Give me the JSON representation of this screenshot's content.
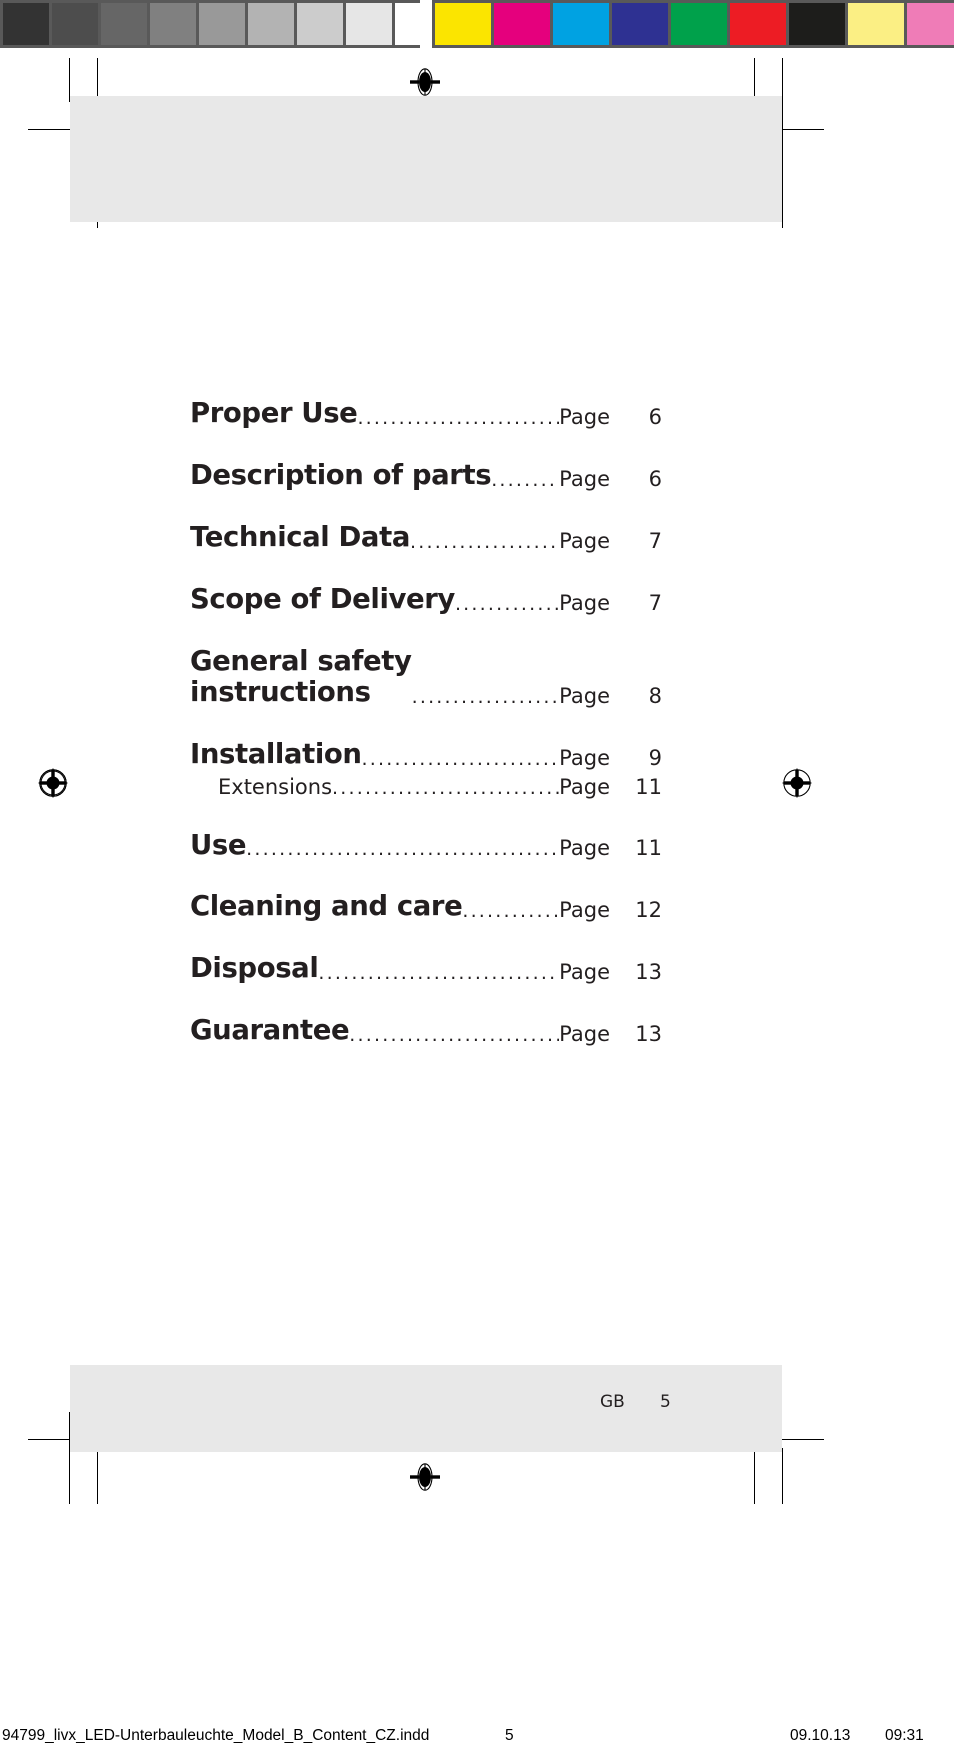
{
  "document": {
    "language_code": "GB",
    "page_number": "5",
    "band_color": "#e8e8e8",
    "text_color": "#231f20"
  },
  "prepress": {
    "gray_bar": {
      "name": "grayscale-control-bar",
      "border_color": "#595959",
      "swatches": [
        "#333333",
        "#4d4d4d",
        "#666666",
        "#808080",
        "#999999",
        "#b3b3b3",
        "#cccccc",
        "#e6e6e6",
        "#ffffff"
      ]
    },
    "color_bar": {
      "name": "process-color-control-bar",
      "border_color": "#595959",
      "swatches": [
        "#fbe500",
        "#e5007d",
        "#00a2e2",
        "#2e3192",
        "#00a14b",
        "#ed1c24",
        "#1d1d1b",
        "#fbef84",
        "#ef7cb7"
      ]
    },
    "registration_marks": 4,
    "crop_marks": true
  },
  "toc": {
    "entries": [
      {
        "title": "Proper Use",
        "page_label": "Page",
        "page": "6",
        "level": 1
      },
      {
        "title": "Description of parts",
        "page_label": "Page",
        "page": "6",
        "level": 1
      },
      {
        "title": "Technical Data",
        "page_label": "Page",
        "page": "7",
        "level": 1
      },
      {
        "title": "Scope of Delivery",
        "page_label": "Page",
        "page": "7",
        "level": 1
      },
      {
        "title": "General safety\ninstructions",
        "page_label": "Page",
        "page": "8",
        "level": 1
      },
      {
        "title": "Installation",
        "page_label": "Page",
        "page": "9",
        "level": 1
      },
      {
        "title": "Extensions",
        "page_label": "Page",
        "page": "11",
        "level": 2
      },
      {
        "title": "Use",
        "page_label": "Page",
        "page": "11",
        "level": 1
      },
      {
        "title": "Cleaning and care",
        "page_label": "Page",
        "page": "12",
        "level": 1
      },
      {
        "title": "Disposal",
        "page_label": "Page",
        "page": "13",
        "level": 1
      },
      {
        "title": "Guarantee",
        "page_label": "Page",
        "page": "13",
        "level": 1
      }
    ],
    "leader_dots": "...................................................................."
  },
  "slug": {
    "filename": "94799_livx_LED-Unterbauleuchte_Model_B_Content_CZ.indd",
    "sheet_number": "5",
    "date": "09.10.13",
    "time": "09:31"
  }
}
